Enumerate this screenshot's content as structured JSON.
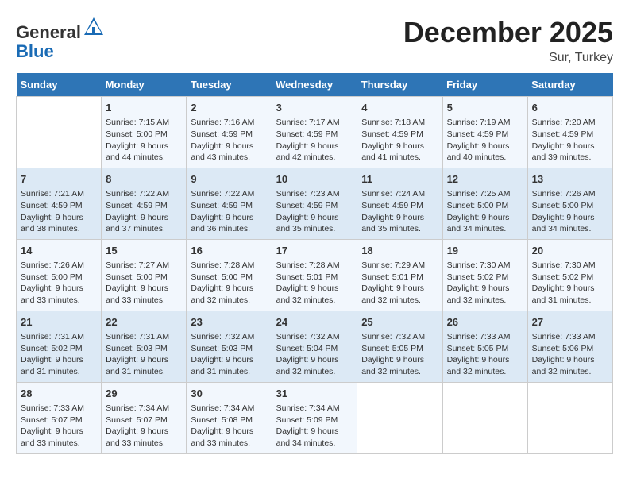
{
  "logo": {
    "general": "General",
    "blue": "Blue"
  },
  "title": "December 2025",
  "location": "Sur, Turkey",
  "days_header": [
    "Sunday",
    "Monday",
    "Tuesday",
    "Wednesday",
    "Thursday",
    "Friday",
    "Saturday"
  ],
  "weeks": [
    [
      {
        "day": "",
        "info": ""
      },
      {
        "day": "1",
        "info": "Sunrise: 7:15 AM\nSunset: 5:00 PM\nDaylight: 9 hours\nand 44 minutes."
      },
      {
        "day": "2",
        "info": "Sunrise: 7:16 AM\nSunset: 4:59 PM\nDaylight: 9 hours\nand 43 minutes."
      },
      {
        "day": "3",
        "info": "Sunrise: 7:17 AM\nSunset: 4:59 PM\nDaylight: 9 hours\nand 42 minutes."
      },
      {
        "day": "4",
        "info": "Sunrise: 7:18 AM\nSunset: 4:59 PM\nDaylight: 9 hours\nand 41 minutes."
      },
      {
        "day": "5",
        "info": "Sunrise: 7:19 AM\nSunset: 4:59 PM\nDaylight: 9 hours\nand 40 minutes."
      },
      {
        "day": "6",
        "info": "Sunrise: 7:20 AM\nSunset: 4:59 PM\nDaylight: 9 hours\nand 39 minutes."
      }
    ],
    [
      {
        "day": "7",
        "info": "Sunrise: 7:21 AM\nSunset: 4:59 PM\nDaylight: 9 hours\nand 38 minutes."
      },
      {
        "day": "8",
        "info": "Sunrise: 7:22 AM\nSunset: 4:59 PM\nDaylight: 9 hours\nand 37 minutes."
      },
      {
        "day": "9",
        "info": "Sunrise: 7:22 AM\nSunset: 4:59 PM\nDaylight: 9 hours\nand 36 minutes."
      },
      {
        "day": "10",
        "info": "Sunrise: 7:23 AM\nSunset: 4:59 PM\nDaylight: 9 hours\nand 35 minutes."
      },
      {
        "day": "11",
        "info": "Sunrise: 7:24 AM\nSunset: 4:59 PM\nDaylight: 9 hours\nand 35 minutes."
      },
      {
        "day": "12",
        "info": "Sunrise: 7:25 AM\nSunset: 5:00 PM\nDaylight: 9 hours\nand 34 minutes."
      },
      {
        "day": "13",
        "info": "Sunrise: 7:26 AM\nSunset: 5:00 PM\nDaylight: 9 hours\nand 34 minutes."
      }
    ],
    [
      {
        "day": "14",
        "info": "Sunrise: 7:26 AM\nSunset: 5:00 PM\nDaylight: 9 hours\nand 33 minutes."
      },
      {
        "day": "15",
        "info": "Sunrise: 7:27 AM\nSunset: 5:00 PM\nDaylight: 9 hours\nand 33 minutes."
      },
      {
        "day": "16",
        "info": "Sunrise: 7:28 AM\nSunset: 5:00 PM\nDaylight: 9 hours\nand 32 minutes."
      },
      {
        "day": "17",
        "info": "Sunrise: 7:28 AM\nSunset: 5:01 PM\nDaylight: 9 hours\nand 32 minutes."
      },
      {
        "day": "18",
        "info": "Sunrise: 7:29 AM\nSunset: 5:01 PM\nDaylight: 9 hours\nand 32 minutes."
      },
      {
        "day": "19",
        "info": "Sunrise: 7:30 AM\nSunset: 5:02 PM\nDaylight: 9 hours\nand 32 minutes."
      },
      {
        "day": "20",
        "info": "Sunrise: 7:30 AM\nSunset: 5:02 PM\nDaylight: 9 hours\nand 31 minutes."
      }
    ],
    [
      {
        "day": "21",
        "info": "Sunrise: 7:31 AM\nSunset: 5:02 PM\nDaylight: 9 hours\nand 31 minutes."
      },
      {
        "day": "22",
        "info": "Sunrise: 7:31 AM\nSunset: 5:03 PM\nDaylight: 9 hours\nand 31 minutes."
      },
      {
        "day": "23",
        "info": "Sunrise: 7:32 AM\nSunset: 5:03 PM\nDaylight: 9 hours\nand 31 minutes."
      },
      {
        "day": "24",
        "info": "Sunrise: 7:32 AM\nSunset: 5:04 PM\nDaylight: 9 hours\nand 32 minutes."
      },
      {
        "day": "25",
        "info": "Sunrise: 7:32 AM\nSunset: 5:05 PM\nDaylight: 9 hours\nand 32 minutes."
      },
      {
        "day": "26",
        "info": "Sunrise: 7:33 AM\nSunset: 5:05 PM\nDaylight: 9 hours\nand 32 minutes."
      },
      {
        "day": "27",
        "info": "Sunrise: 7:33 AM\nSunset: 5:06 PM\nDaylight: 9 hours\nand 32 minutes."
      }
    ],
    [
      {
        "day": "28",
        "info": "Sunrise: 7:33 AM\nSunset: 5:07 PM\nDaylight: 9 hours\nand 33 minutes."
      },
      {
        "day": "29",
        "info": "Sunrise: 7:34 AM\nSunset: 5:07 PM\nDaylight: 9 hours\nand 33 minutes."
      },
      {
        "day": "30",
        "info": "Sunrise: 7:34 AM\nSunset: 5:08 PM\nDaylight: 9 hours\nand 33 minutes."
      },
      {
        "day": "31",
        "info": "Sunrise: 7:34 AM\nSunset: 5:09 PM\nDaylight: 9 hours\nand 34 minutes."
      },
      {
        "day": "",
        "info": ""
      },
      {
        "day": "",
        "info": ""
      },
      {
        "day": "",
        "info": ""
      }
    ]
  ]
}
